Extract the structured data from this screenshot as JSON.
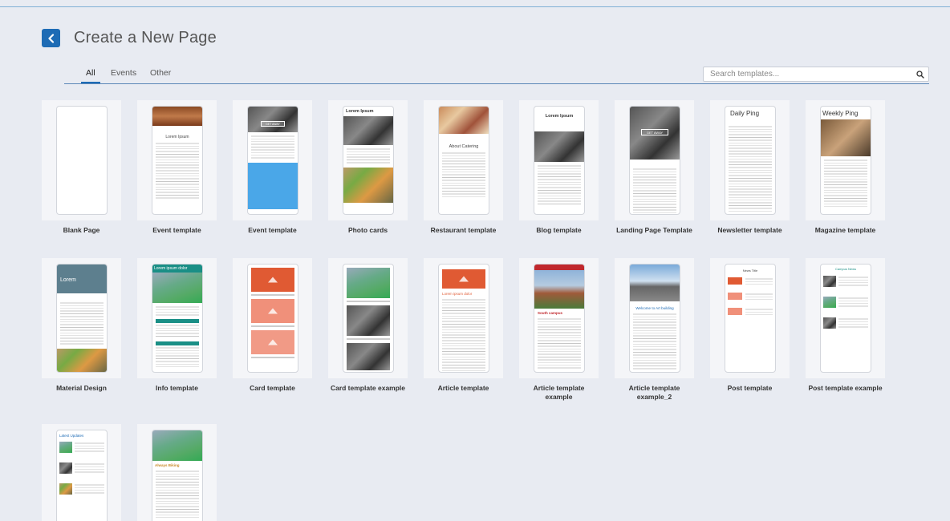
{
  "header": {
    "title": "Create a New Page",
    "back_icon": "chevron-left-icon"
  },
  "tabs": [
    {
      "label": "All",
      "active": true
    },
    {
      "label": "Events",
      "active": false
    },
    {
      "label": "Other",
      "active": false
    }
  ],
  "search": {
    "placeholder": "Search templates...",
    "value": "",
    "icon": "search-icon"
  },
  "templates": [
    {
      "label": "Blank Page"
    },
    {
      "label": "Event template",
      "preview_heading": "Lorem Ipsum"
    },
    {
      "label": "Event template",
      "preview_heading": "GET AWAY"
    },
    {
      "label": "Photo cards",
      "preview_heading": "Lorem Ipsum"
    },
    {
      "label": "Restaurant template",
      "preview_heading": "About Catering"
    },
    {
      "label": "Blog template",
      "preview_heading": "Lorem Ipsum"
    },
    {
      "label": "Landing Page Template",
      "preview_heading": "GET AWAY"
    },
    {
      "label": "Newsletter template",
      "preview_heading": "Daily Ping"
    },
    {
      "label": "Magazine template",
      "preview_heading": "Weekly Ping"
    },
    {
      "label": "Material Design",
      "preview_heading": "Lorem"
    },
    {
      "label": "Info template",
      "preview_heading": "Lorem ipsum dolor"
    },
    {
      "label": "Card template"
    },
    {
      "label": "Card template example"
    },
    {
      "label": "Article template",
      "preview_heading": "Lorem ipsum dolor"
    },
    {
      "label": "Article template example",
      "preview_heading": "South campus"
    },
    {
      "label": "Article template example_2",
      "preview_heading": "Welcome to Art building"
    },
    {
      "label": "Post template",
      "preview_heading": "News Title"
    },
    {
      "label": "Post template example",
      "preview_heading": "Campus News"
    },
    {
      "label": "",
      "preview_heading": "Latest Updates"
    },
    {
      "label": "",
      "preview_heading": "Always Biking"
    }
  ],
  "colors": {
    "accent": "#1d6bb5",
    "background": "#e8ebf2"
  }
}
